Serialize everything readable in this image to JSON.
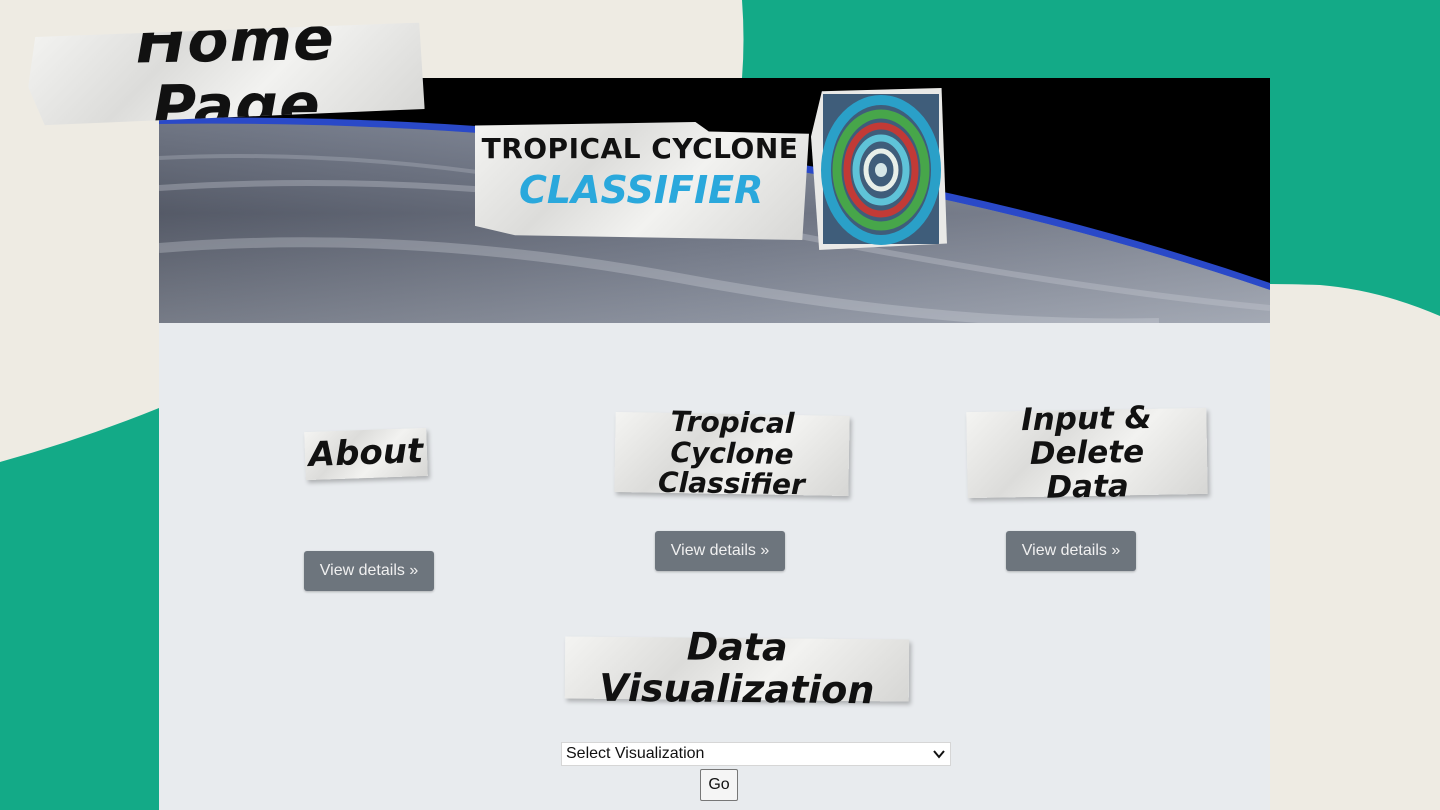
{
  "slide": {
    "tag": "Home Page",
    "colors": {
      "background": "#eeebe3",
      "accent": "#13aa87"
    }
  },
  "site": {
    "logo": {
      "line1": "TROPICAL CYCLONE",
      "line2": "CLASSIFIER",
      "line2_color": "#2aa8dc",
      "image": "cyclone-swirl-icon"
    },
    "banner_image": "earth-horizon-from-space"
  },
  "sections": [
    {
      "heading": "About",
      "button": "View details »"
    },
    {
      "heading_line1": "Tropical Cyclone",
      "heading_line2": "Classifier",
      "button": "View details »"
    },
    {
      "heading_line1": "Input & Delete",
      "heading_line2": "Data",
      "button": "View details »"
    }
  ],
  "visualization": {
    "heading": "Data Visualization",
    "select_value": "Select Visualization",
    "go_label": "Go"
  },
  "colors": {
    "button_bg": "#6d757d",
    "page_bg": "#e8ebee"
  }
}
